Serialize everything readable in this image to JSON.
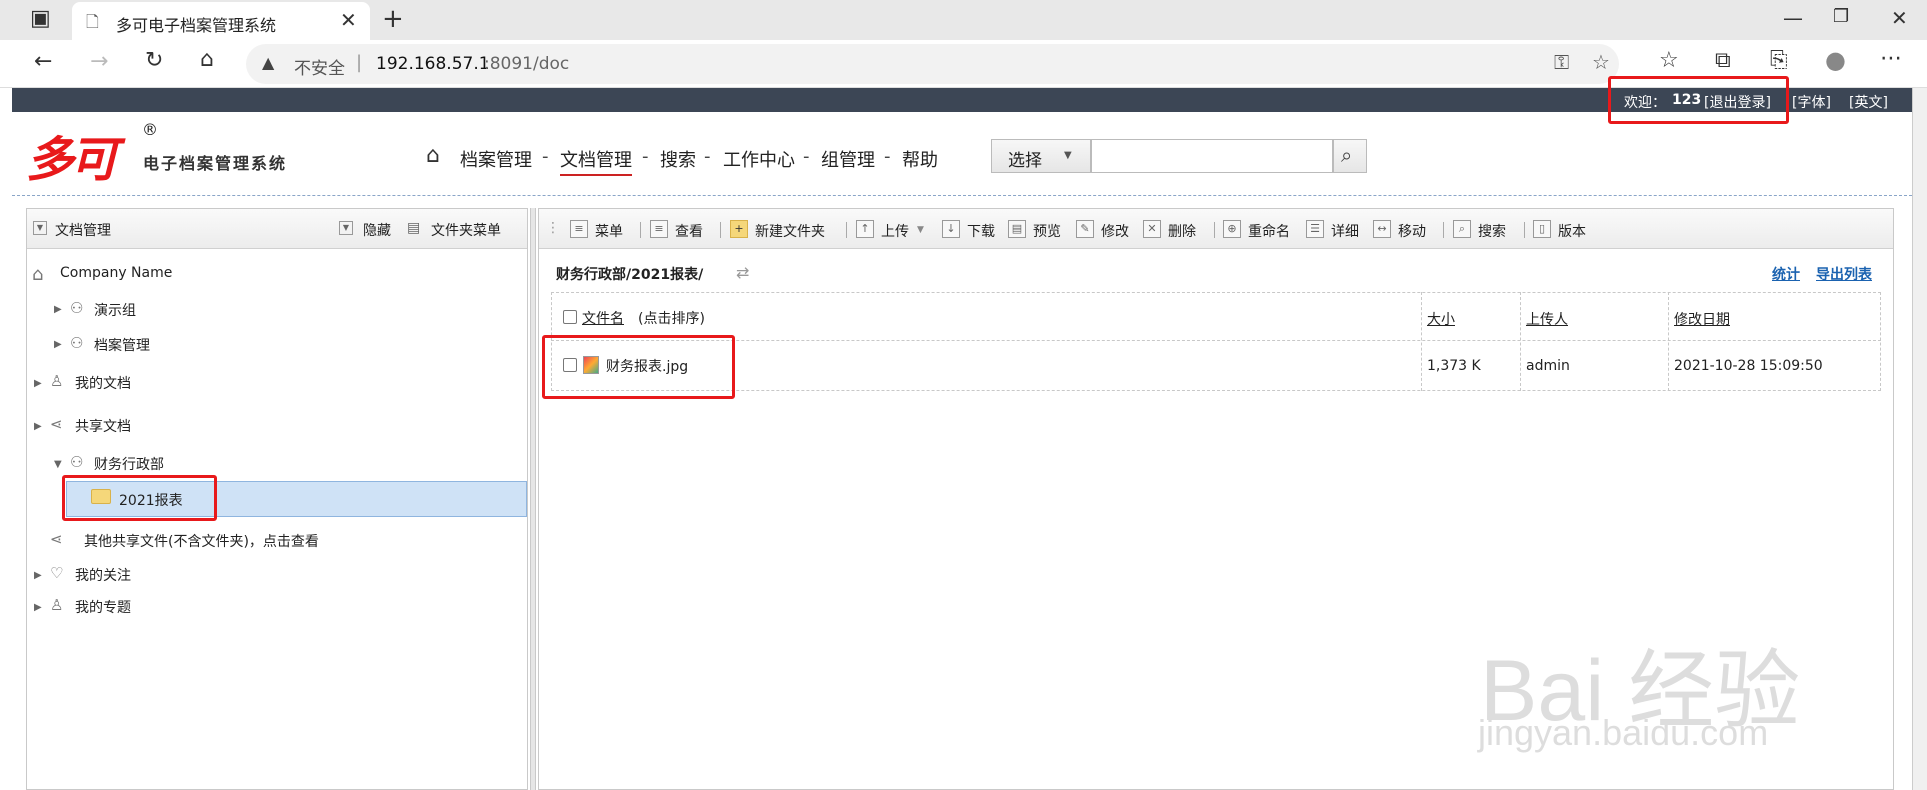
{
  "browser": {
    "tab_title": "多可电子档案管理系统",
    "insecure_label": "不安全",
    "url_host": "192.168.57.1",
    "url_rest": ":8091/doc"
  },
  "topbar": {
    "welcome": "欢迎：",
    "user": "123",
    "logout": "[退出登录]",
    "font": "[字体]",
    "english": "[英文]"
  },
  "logo": {
    "brand": "多可",
    "registered": "®",
    "subtitle": "电子档案管理系统"
  },
  "nav": {
    "items": [
      "档案管理",
      "文档管理",
      "搜索",
      "工作中心",
      "组管理",
      "帮助"
    ],
    "active_index": 1,
    "separator": "-"
  },
  "search": {
    "select_label": "选择",
    "placeholder": ""
  },
  "left_panel": {
    "title": "文档管理",
    "hide": "隐藏",
    "folder_menu": "文件夹菜单",
    "tree": {
      "company": "Company Name",
      "demo_group": "演示组",
      "archive_mgmt": "档案管理",
      "my_docs": "我的文档",
      "shared_docs": "共享文档",
      "finance_dept": "财务行政部",
      "selected_folder": "2021报表",
      "other_shared": "其他共享文件(不含文件夹)，点击查看",
      "my_follows": "我的关注",
      "my_topics": "我的专题"
    }
  },
  "toolbar": {
    "items": [
      "菜单",
      "查看",
      "新建文件夹",
      "上传",
      "下载",
      "预览",
      "修改",
      "删除",
      "重命名",
      "详细",
      "移动",
      "搜索",
      "版本"
    ]
  },
  "content": {
    "breadcrumb": "财务行政部/2021报表/",
    "stats": "统计",
    "export": "导出列表",
    "columns": {
      "name": "文件名",
      "sort_hint": "(点击排序)",
      "size": "大小",
      "uploader": "上传人",
      "modified": "修改日期"
    },
    "rows": [
      {
        "name": "财务报表.jpg",
        "size": "1,373 K",
        "uploader": "admin",
        "modified": "2021-10-28 15:09:50"
      }
    ]
  },
  "watermark": {
    "main": "Bai 经验",
    "sub": "jingyan.baidu.com"
  },
  "colors": {
    "accent_red": "#e8191b",
    "link_blue": "#1a62b0",
    "top_strip": "#3c4655",
    "selection": "#cfe2f6"
  }
}
